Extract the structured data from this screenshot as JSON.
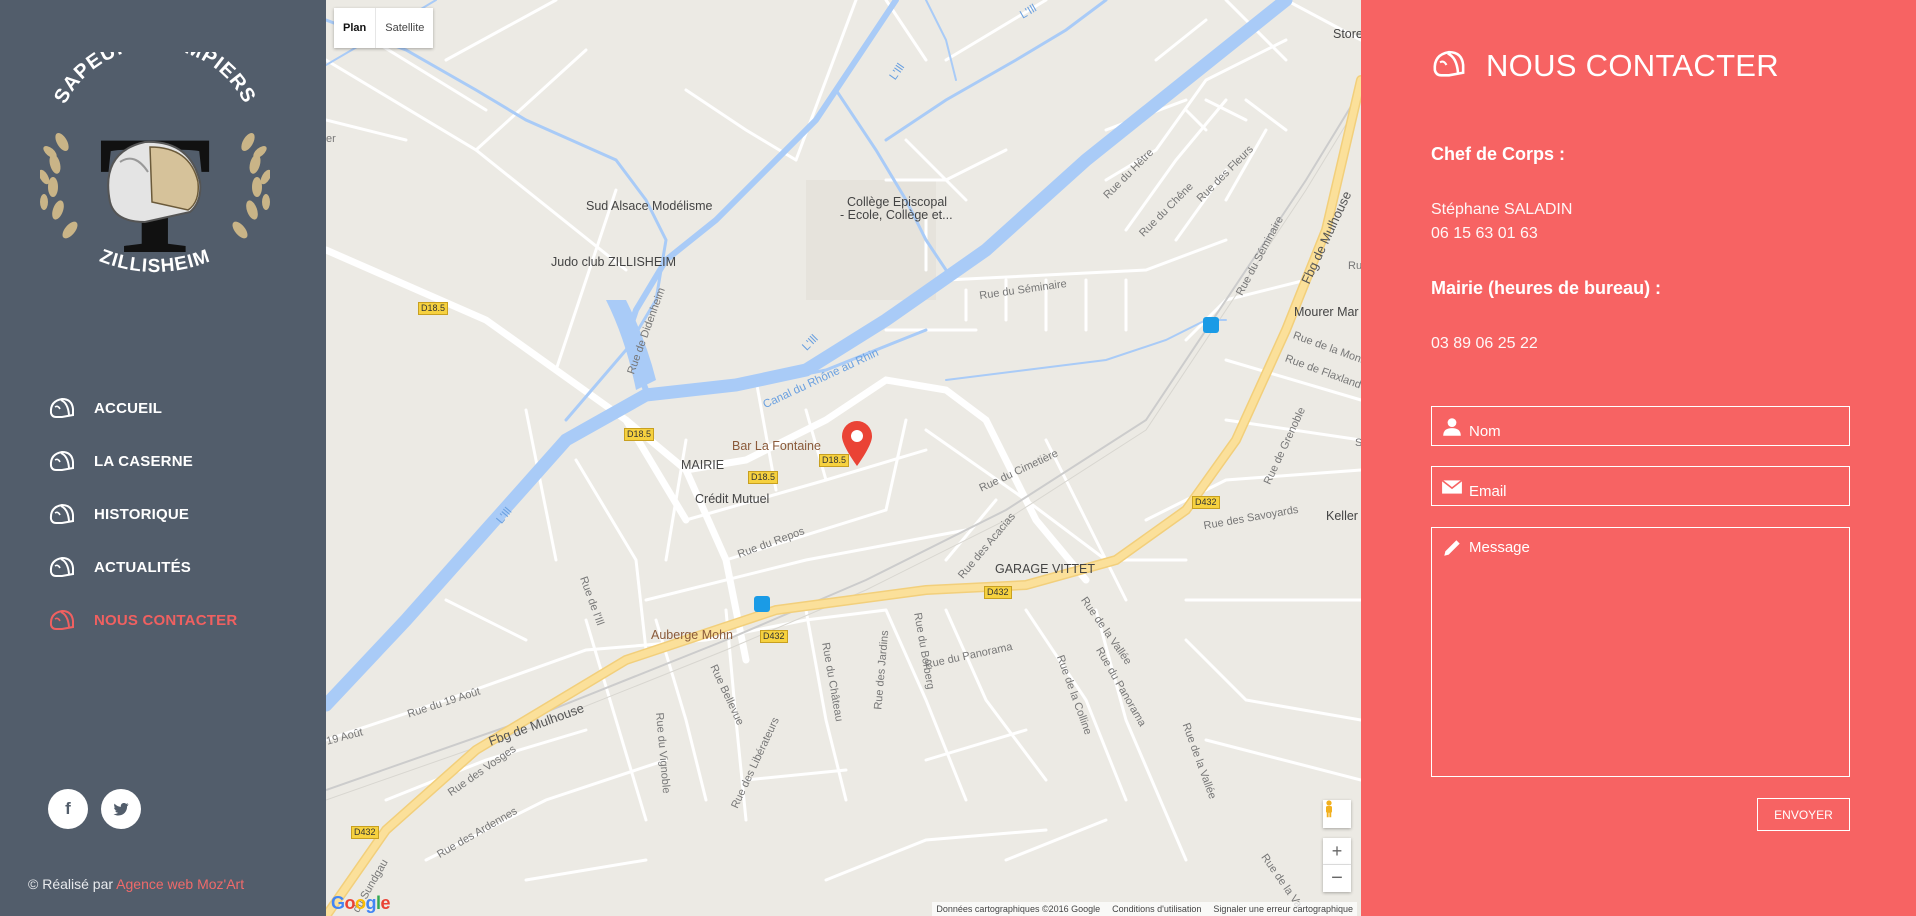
{
  "logo": {
    "top_text": "SAPEURS POMPIERS",
    "bottom_text": "ZILLISHEIM",
    "letter": "T"
  },
  "nav": {
    "items": [
      {
        "label": "ACCUEIL"
      },
      {
        "label": "LA CASERNE"
      },
      {
        "label": "HISTORIQUE"
      },
      {
        "label": "ACTUALITÉS"
      },
      {
        "label": "NOUS CONTACTER"
      }
    ],
    "active": "NOUS CONTACTER"
  },
  "social": {
    "facebook": "f",
    "twitter": "t"
  },
  "credit": {
    "prefix": "© Réalisé par",
    "link": "Agence web Moz'Art"
  },
  "map": {
    "type_plan": "Plan",
    "type_satellite": "Satellite",
    "labels": {
      "sud_alsace": "Sud Alsace Modélisme",
      "judo": "Judo club ZILLISHEIM",
      "college1": "Collège Episcopal",
      "college2": "- Ecole, Collège et...",
      "bar": "Bar La Fontaine",
      "mairie": "MAIRIE",
      "credit_mutuel": "Crédit Mutuel",
      "garage": "GARAGE VITTET",
      "auberge": "Auberge Mohn",
      "mourer": "Mourer Mar",
      "keller": "Keller L",
      "store": "Store",
      "rue_seminaire": "Rue du Séminaire",
      "rue_seminaire2": "Rue du Séminaire",
      "rue_cimetiere": "Rue du Cimetière",
      "rue_repos": "Rue du Repos",
      "rue_acacias": "Rue des Acacias",
      "rue_didenheim": "Rue de Didenheim",
      "rue_ill": "Rue de l'Ill",
      "rue_hetre": "Rue du Hêtre",
      "rue_chene": "Rue du Chêne",
      "rue_fleurs": "Rue des Fleurs",
      "rue_savoyards": "Rue des Savoyards",
      "rue_grenoble": "Rue de Grenoble",
      "rue_montagne": "Rue de la Monta",
      "rue_flaxland": "Rue de Flaxland",
      "rue_19aout": "Rue du 19 Août",
      "rue_19aout_b": "19 Août",
      "rue_bellevue": "Rue Bellevue",
      "rue_chateau": "Rue du Château",
      "rue_jardins": "Rue des Jardins",
      "rue_borberg": "Rue du Borberg",
      "rue_panorama": "Rue du Panorama",
      "rue_panorama2": "Rue du Panorama",
      "rue_colline": "Rue de la Colline",
      "rue_vallee": "Rue de la Vallée",
      "rue_vallee2": "Rue de la Vallée",
      "rue_vallee3": "Rue de la Va",
      "rue_vignoble": "Rue du Vignoble",
      "rue_vosges": "Rue des Vosges",
      "rue_liberateurs": "Rue des Libérateurs",
      "rue_ardennes": "Rue des Ardennes",
      "rue_sundgau": "du Sundgau",
      "fbg_mulhouse": "Fbg de Mulhouse",
      "fbg_mulhouse2": "Fbg de Mulhouse",
      "canal": "Canal du Rhône au Rhin",
      "ill1": "L'Ill",
      "ill2": "L'Ill",
      "ill3": "L'Ill",
      "ill4": "L'Ill",
      "d185": "D18.5",
      "d432": "D432",
      "edge_er": "er",
      "edge_ru": "Ru",
      "edge_s": "S"
    },
    "attribution": [
      "Données cartographiques ©2016 Google",
      "Conditions d'utilisation",
      "Signaler une erreur cartographique"
    ],
    "google": "Google",
    "zoom_in": "+",
    "zoom_out": "−"
  },
  "contact": {
    "title": "NOUS CONTACTER",
    "chef_heading": "Chef de Corps :",
    "chef_name": "Stéphane SALADIN",
    "chef_phone": "06 15 63 01 63",
    "mairie_heading": "Mairie (heures de bureau) :",
    "mairie_phone": "03 89 06 25 22",
    "form": {
      "name_placeholder": "Nom",
      "email_placeholder": "Email",
      "message_placeholder": "Message",
      "submit": "ENVOYER"
    }
  },
  "colors": {
    "sidebar": "#525d6b",
    "accent": "#f76363",
    "active_nav": "#f06060",
    "map_bg": "#eceae4",
    "water": "#a9cbf7",
    "major_road": "#fbe09a"
  }
}
